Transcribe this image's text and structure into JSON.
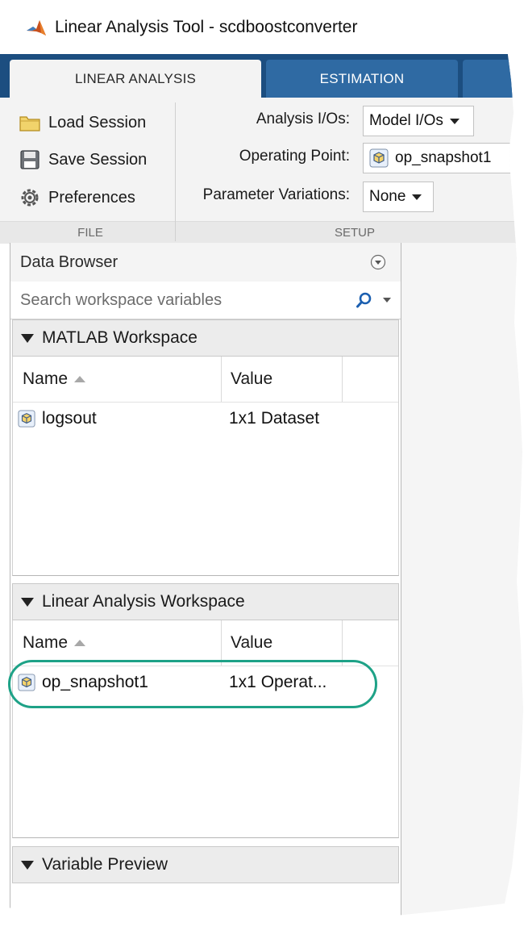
{
  "window": {
    "title": "Linear Analysis Tool - scdboostconverter",
    "app_icon": "matlab-icon"
  },
  "tabs": [
    {
      "label": "LINEAR ANALYSIS",
      "active": true
    },
    {
      "label": "ESTIMATION",
      "active": false
    },
    {
      "label": "",
      "active": false
    }
  ],
  "toolstrip": {
    "file": {
      "load_session": "Load Session",
      "save_session": "Save Session",
      "preferences": "Preferences",
      "section_label": "FILE"
    },
    "setup": {
      "analysis_ios_label": "Analysis I/Os:",
      "analysis_ios_value": "Model I/Os",
      "operating_point_label": "Operating Point:",
      "operating_point_value": "op_snapshot1",
      "parameter_variations_label": "Parameter Variations:",
      "parameter_variations_value": "None",
      "section_label": "SETUP"
    }
  },
  "data_browser": {
    "title": "Data Browser",
    "search_placeholder": "Search workspace variables",
    "matlab_workspace": {
      "title": "MATLAB Workspace",
      "columns": {
        "name": "Name",
        "value": "Value"
      },
      "rows": [
        {
          "name": "logsout",
          "value": "1x1 Dataset"
        }
      ]
    },
    "linear_workspace": {
      "title": "Linear Analysis Workspace",
      "columns": {
        "name": "Name",
        "value": "Value"
      },
      "rows": [
        {
          "name": "op_snapshot1",
          "value": "1x1 Operat..."
        }
      ]
    },
    "variable_preview": {
      "title": "Variable Preview"
    }
  },
  "colors": {
    "tab_strip": "#1c4e80",
    "tab_inactive": "#2f6aa3",
    "highlight": "#1ea287"
  }
}
